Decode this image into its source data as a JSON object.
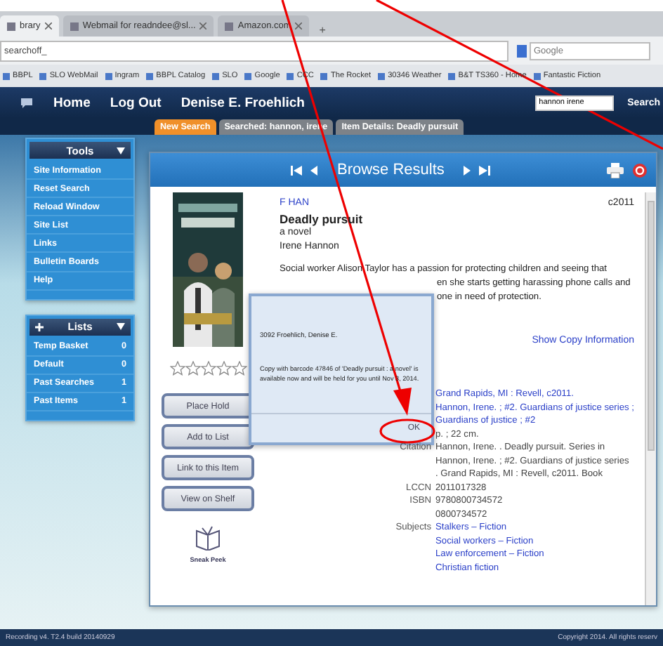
{
  "browser": {
    "tabs": [
      {
        "label": "brary",
        "selected": true
      },
      {
        "label": "Webmail for readndee@sl...",
        "selected": false
      },
      {
        "label": "Amazon.com",
        "selected": false
      }
    ],
    "new_tab": "+",
    "address": "searchoff_",
    "search_placeholder": "Google",
    "bookmarks": [
      "BBPL",
      "SLO WebMail",
      "Ingram",
      "BBPL Catalog",
      "SLO",
      "Google",
      "CCC",
      "The Rocket",
      "30346 Weather",
      "B&T TS360 - Home",
      "Fantastic Fiction"
    ]
  },
  "header": {
    "nav": [
      "Home",
      "Log Out"
    ],
    "user": "Denise E. Froehlich",
    "search_value": "hannon irene",
    "search_button": "Search"
  },
  "breadcrumbs": [
    {
      "label": "New Search",
      "selected": true
    },
    {
      "label": "Searched: hannon, irene",
      "selected": false
    },
    {
      "label": "Item Details: Deadly pursuit",
      "selected": false
    }
  ],
  "sidebar": [
    {
      "title": "Tools",
      "items": [
        {
          "label": "Site Information"
        },
        {
          "label": "Reset Search"
        },
        {
          "label": "Reload Window"
        },
        {
          "label": "Site List"
        },
        {
          "label": "Links"
        },
        {
          "label": "Bulletin Boards"
        },
        {
          "label": "Help"
        }
      ]
    },
    {
      "title": "Lists",
      "items": [
        {
          "label": "Temp Basket",
          "count": "0"
        },
        {
          "label": "Default",
          "count": "0"
        },
        {
          "label": "Past Searches",
          "count": "1"
        },
        {
          "label": "Past Items",
          "count": "1"
        }
      ]
    }
  ],
  "browse": {
    "title": "Browse Results",
    "stars": 0,
    "call_number": "F HAN",
    "title_text": "Deadly pursuit",
    "subtitle": "a novel",
    "author": "Irene Hannon",
    "date": "c2011",
    "summary_lines": [
      "Social worker Alison Taylor has a passion for protecting children and seeing that",
      "en she starts getting harassing phone calls and",
      "one in need of protection."
    ],
    "show_copy": "Show Copy Information",
    "actions": [
      "Place Hold",
      "Add to List",
      "Link to this Item",
      "View on Shelf"
    ],
    "sneak_peek": "Sneak Peek",
    "details": [
      {
        "kind": "link",
        "values": [
          "Grand Rapids, MI : Revell, c2011."
        ]
      },
      {
        "kind": "link",
        "values": [
          "Hannon, Irene. ; #2. Guardians of justice series ;"
        ]
      },
      {
        "kind": "link",
        "values": [
          "Guardians of justice ; #2"
        ]
      },
      {
        "kind": "text",
        "values": [
          "p. ; 22 cm."
        ]
      },
      {
        "kind": "text",
        "label": "Citation",
        "values": [
          "Hannon, Irene. . Deadly pursuit. Series in",
          "Hannon, Irene. ; #2. Guardians of justice series",
          ". Grand Rapids, MI : Revell, c2011. Book"
        ]
      },
      {
        "kind": "text",
        "label": "LCCN",
        "values": [
          "2011017328"
        ]
      },
      {
        "kind": "text",
        "label": "ISBN",
        "values": [
          "9780800734572",
          "0800734572"
        ]
      },
      {
        "kind": "link",
        "label": "Subjects",
        "values": [
          "Stalkers – Fiction",
          "Social workers – Fiction",
          "Law enforcement – Fiction",
          "Christian fiction"
        ]
      }
    ]
  },
  "dialog": {
    "patron": "3092 Froehlich, Denise E.",
    "message": "Copy with barcode 47846 of 'Deadly pursuit : a novel' is available now and will be held for you until Nov 3, 2014.",
    "ok": "OK"
  },
  "footer": {
    "version": "Recording v4. T2.4 build 20140929",
    "copyright": "Copyright 2014. All rights reserv"
  }
}
